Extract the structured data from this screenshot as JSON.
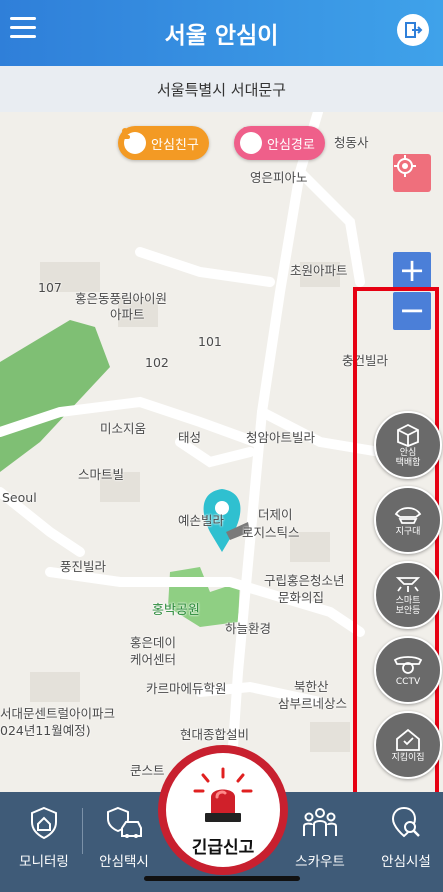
{
  "app": {
    "title": "서울 안심이"
  },
  "location": {
    "district": "서울특별시 서대문구"
  },
  "map": {
    "pills": {
      "friend": "안심친구",
      "route": "안심경로"
    },
    "zoom": {
      "in": "+",
      "out": "−"
    },
    "labels": {
      "church": "청동사",
      "piano": "영은피아노",
      "chowon": "초원아파트",
      "heungeun_apt": "홍은동풍림아이원",
      "apt": "아파트",
      "jung_villa": "충건빌라",
      "misojium": "미소지움",
      "taeseong": "태성",
      "cheongam": "청암아트빌라",
      "smartville": "스마트빌",
      "seoul": "Seoul",
      "yeson": "예손빌라",
      "dejay": "더제이",
      "logistics": "로지스틱스",
      "punggin": "풍진빌라",
      "youth1": "구립홍은청소년",
      "youth2": "문화의집",
      "park": "홍박공원",
      "sky": "하늘환경",
      "heungeun_care1": "홍은데이",
      "heungeun_care2": "케어센터",
      "karma": "카르마에듀학원",
      "bukhansan1": "북한산",
      "bukhansan2": "삼부르네상스",
      "center1": "서대문센트럴아이파크",
      "center2": "024년11월예정)",
      "hyundai": "현대종합설비",
      "kunst": "쿤스트",
      "num107": "107",
      "num102": "102",
      "num101": "101"
    }
  },
  "facilities": [
    {
      "label": "안심\n택배함",
      "icon": "parcel-box-icon"
    },
    {
      "label": "지구대",
      "icon": "police-cap-icon"
    },
    {
      "label": "스마트\n보안등",
      "icon": "streetlight-icon"
    },
    {
      "label": "CCTV",
      "icon": "cctv-icon"
    },
    {
      "label": "지킴이집",
      "icon": "guard-house-icon"
    }
  ],
  "bottom_nav": {
    "monitoring": "모니터링",
    "taxi": "안심택시",
    "emergency": "긴급신고",
    "scout": "스카우트",
    "facility": "안심시설"
  },
  "colors": {
    "header": "#2f7fd9",
    "bottom_bar": "#3f5b78",
    "emergency": "#c8202f",
    "highlight": "#e60012",
    "pin": "#2fc0d0"
  }
}
